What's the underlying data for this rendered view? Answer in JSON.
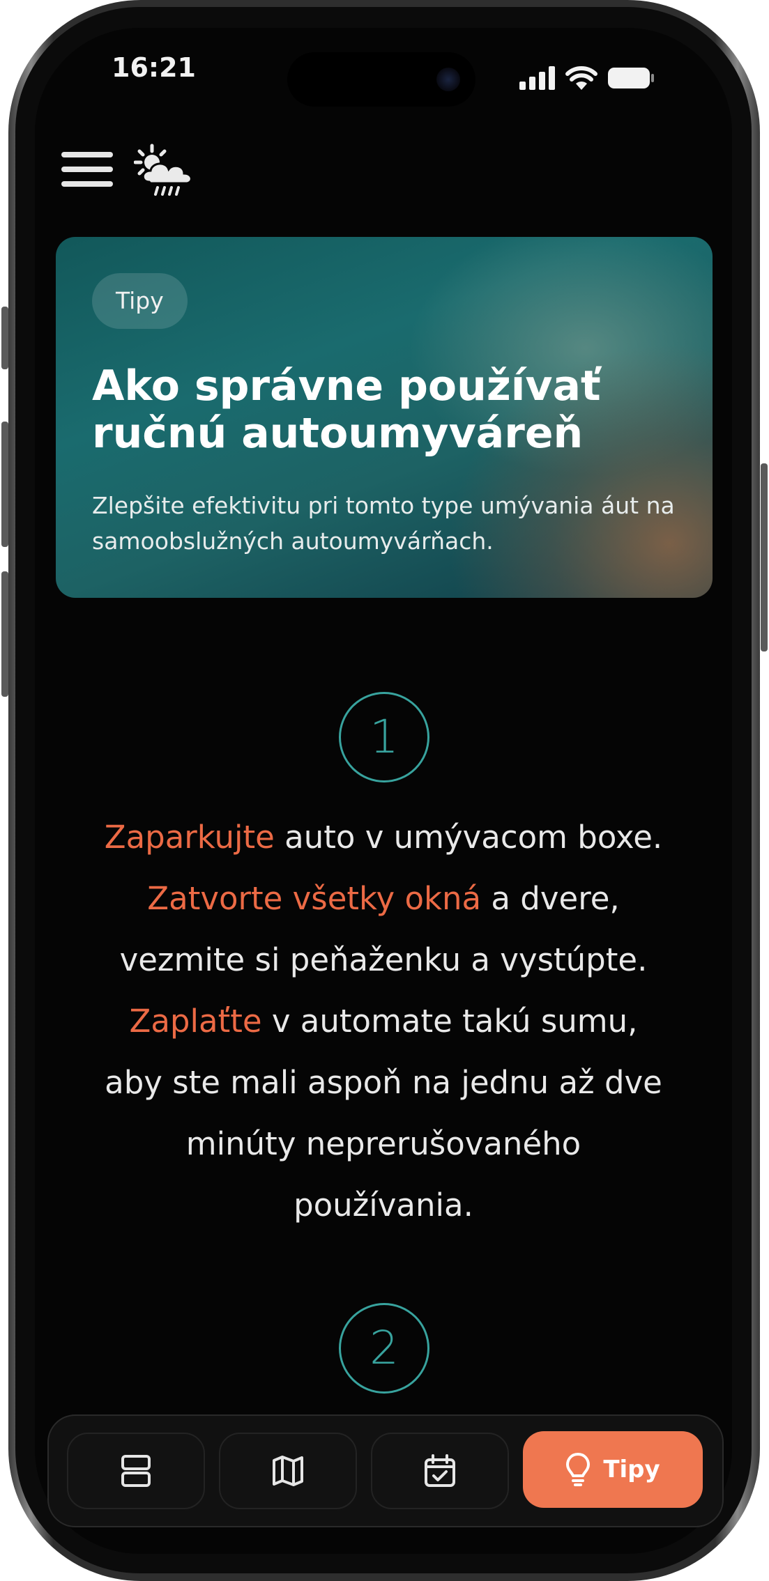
{
  "status_bar": {
    "time": "16:21"
  },
  "header": {
    "menu_icon": "hamburger-menu-icon",
    "logo_icon": "sun-cloud-rain-icon"
  },
  "hero": {
    "tag": "Tipy",
    "title": "Ako správne používať ručnú autoumyváreň",
    "description": "Zlepšite efektivitu pri tomto type umývania áut na samoobslužných autoumyvárňach."
  },
  "steps": [
    {
      "number": "1",
      "line1_accent": "Zaparkujte",
      "line1_rest": " auto v umývacom boxe.",
      "line2_accent": "Zatvorte všetky okná",
      "line2_rest": " a dvere,",
      "line3": "vezmite si peňaženku a vystúpte.",
      "line4_accent": "Zaplaťte",
      "line4_rest": " v automate takú sumu,",
      "line5": "aby ste mali aspoň na jednu až dve",
      "line6": "minúty neprerušovaného",
      "line7": "používania."
    },
    {
      "number": "2"
    }
  ],
  "bottom_nav": {
    "items": [
      {
        "icon": "list-layout-icon"
      },
      {
        "icon": "map-icon"
      },
      {
        "icon": "calendar-check-icon"
      }
    ],
    "active": {
      "icon": "lightbulb-icon",
      "label": "Tipy"
    }
  },
  "colors": {
    "accent": "#ec6a45",
    "teal": "#38a39e",
    "nav_active": "#ef7750",
    "background": "#050505"
  }
}
